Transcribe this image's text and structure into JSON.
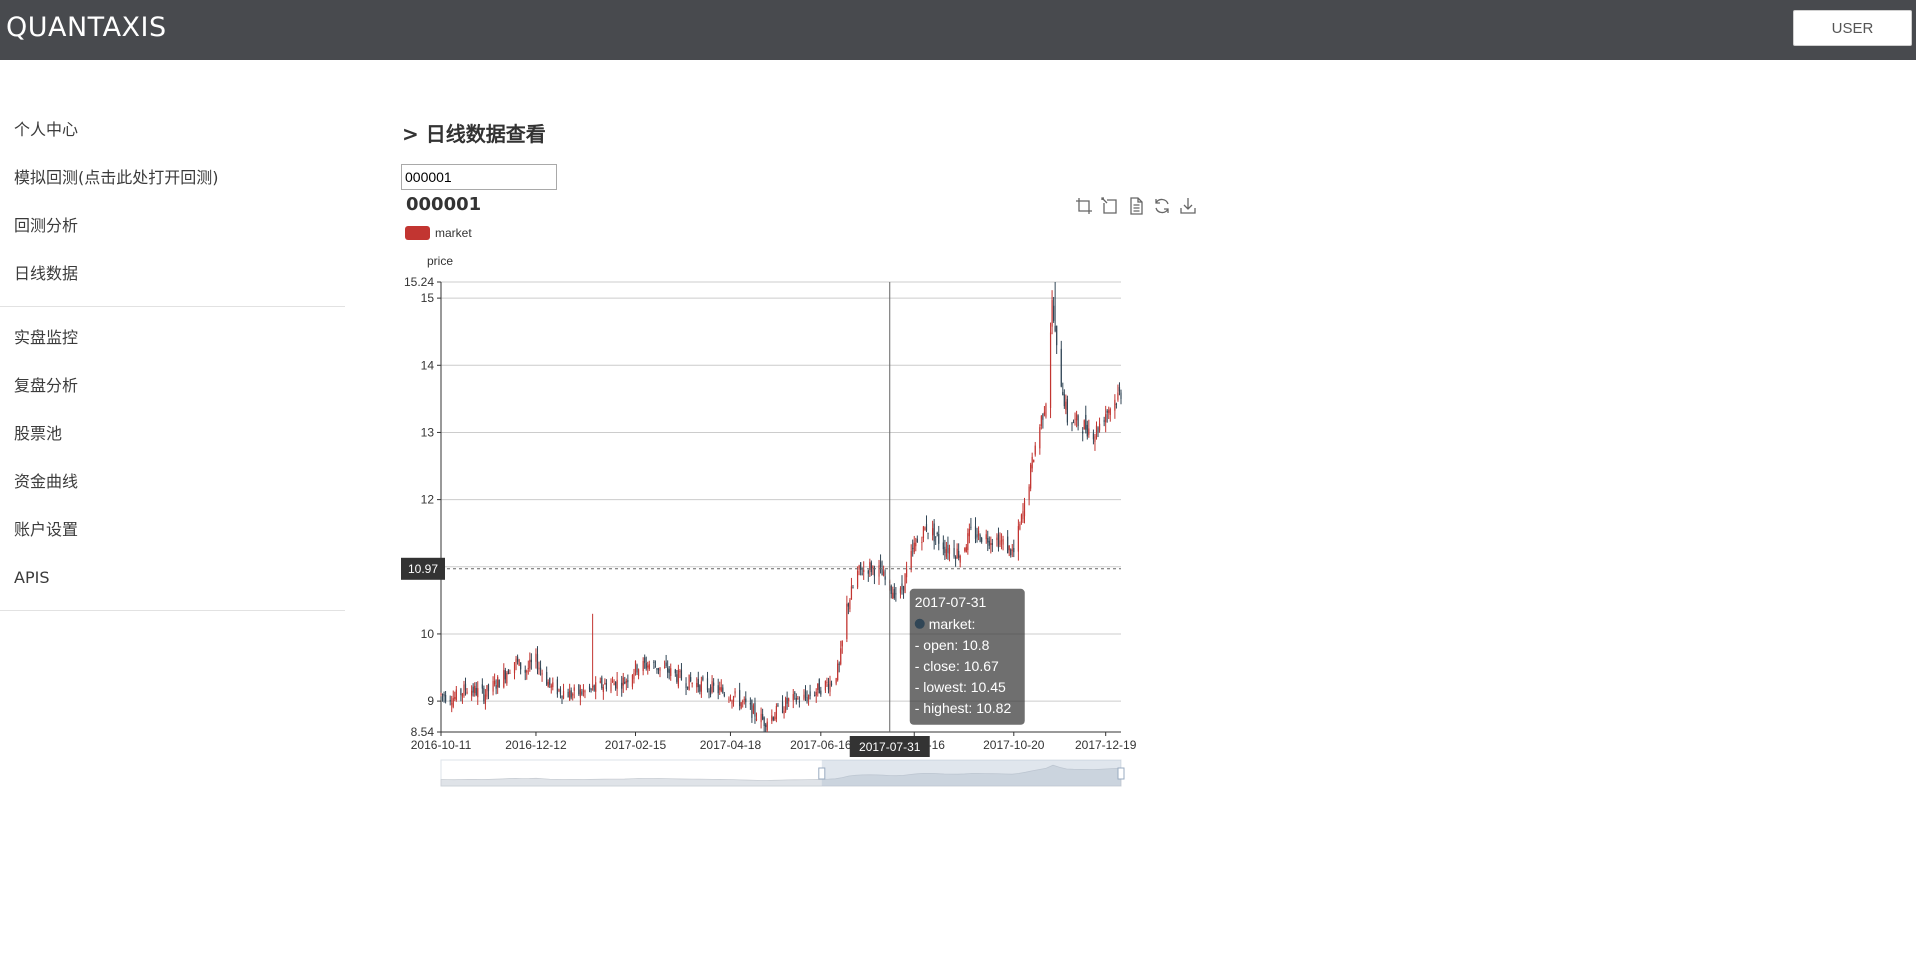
{
  "app": {
    "brand": "QUANTAXIS",
    "user_button": "USER"
  },
  "sidebar": {
    "group1": [
      {
        "label": "个人中心"
      },
      {
        "label": "模拟回测(点击此处打开回测)"
      },
      {
        "label": "回测分析"
      },
      {
        "label": "日线数据"
      }
    ],
    "group2": [
      {
        "label": "实盘监控"
      },
      {
        "label": "复盘分析"
      },
      {
        "label": "股票池"
      },
      {
        "label": "资金曲线"
      },
      {
        "label": "账户设置"
      },
      {
        "label": "APIS"
      }
    ]
  },
  "main": {
    "title": "> 日线数据查看",
    "code_input_value": "000001"
  },
  "chart_data": {
    "type": "candlestick",
    "title": "000001",
    "legend": [
      "market"
    ],
    "ylabel": "price",
    "ylim": [
      8.54,
      15.24
    ],
    "yticks": [
      8.54,
      9,
      10,
      11,
      12,
      13,
      14,
      15,
      15.24
    ],
    "x_range": [
      "2016-10-11",
      "2017-12-29"
    ],
    "xticks": [
      "2016-10-11",
      "2016-12-12",
      "2017-02-15",
      "2017-04-18",
      "2017-06-16",
      "2017-08-16",
      "2017-10-20",
      "2017-12-19"
    ],
    "colors": {
      "up": "#c23531",
      "down": "#314656",
      "grid": "#cccccc",
      "axis": "#333333"
    },
    "approx_close_path": [
      [
        "2016-10-11",
        9.1
      ],
      [
        "2016-10-20",
        9.05
      ],
      [
        "2016-10-28",
        9.2
      ],
      [
        "2016-11-08",
        9.1
      ],
      [
        "2016-11-18",
        9.3
      ],
      [
        "2016-11-28",
        9.6
      ],
      [
        "2016-12-05",
        9.45
      ],
      [
        "2016-12-12",
        9.6
      ],
      [
        "2016-12-22",
        9.2
      ],
      [
        "2017-01-04",
        9.1
      ],
      [
        "2017-01-16",
        9.15
      ],
      [
        "2017-01-26",
        9.25
      ],
      [
        "2017-02-08",
        9.3
      ],
      [
        "2017-02-15",
        9.5
      ],
      [
        "2017-02-24",
        9.55
      ],
      [
        "2017-03-08",
        9.45
      ],
      [
        "2017-03-20",
        9.3
      ],
      [
        "2017-04-05",
        9.2
      ],
      [
        "2017-04-18",
        9.1
      ],
      [
        "2017-04-27",
        8.95
      ],
      [
        "2017-05-10",
        8.7
      ],
      [
        "2017-05-19",
        8.85
      ],
      [
        "2017-05-26",
        9.0
      ],
      [
        "2017-06-06",
        9.05
      ],
      [
        "2017-06-16",
        9.2
      ],
      [
        "2017-06-23",
        9.3
      ],
      [
        "2017-06-28",
        9.5
      ],
      [
        "2017-07-03",
        10.4
      ],
      [
        "2017-07-10",
        10.9
      ],
      [
        "2017-07-17",
        11.0
      ],
      [
        "2017-07-24",
        10.95
      ],
      [
        "2017-07-31",
        10.67
      ],
      [
        "2017-08-07",
        10.6
      ],
      [
        "2017-08-16",
        11.3
      ],
      [
        "2017-08-24",
        11.6
      ],
      [
        "2017-09-05",
        11.3
      ],
      [
        "2017-09-15",
        11.2
      ],
      [
        "2017-09-22",
        11.5
      ],
      [
        "2017-10-10",
        11.4
      ],
      [
        "2017-10-20",
        11.2
      ],
      [
        "2017-10-27",
        11.9
      ],
      [
        "2017-11-03",
        12.8
      ],
      [
        "2017-11-10",
        13.5
      ],
      [
        "2017-11-14",
        14.9
      ],
      [
        "2017-11-17",
        14.2
      ],
      [
        "2017-11-24",
        13.2
      ],
      [
        "2017-12-05",
        13.1
      ],
      [
        "2017-12-12",
        13.0
      ],
      [
        "2017-12-19",
        13.3
      ],
      [
        "2017-12-29",
        13.6
      ]
    ],
    "spikes": [
      [
        "2017-01-18",
        10.3
      ],
      [
        "2017-11-16",
        15.24
      ]
    ],
    "crosshair": {
      "x_label": "2017-07-31",
      "y_label": "10.97",
      "y_value": 10.97
    },
    "tooltip": {
      "date": "2017-07-31",
      "series": "market:",
      "lines": [
        "- open: 10.8",
        "- close: 10.67",
        "- lowest: 10.45",
        "- highest: 10.82"
      ]
    },
    "datazoom": {
      "start": 0.56,
      "end": 1.0
    }
  }
}
